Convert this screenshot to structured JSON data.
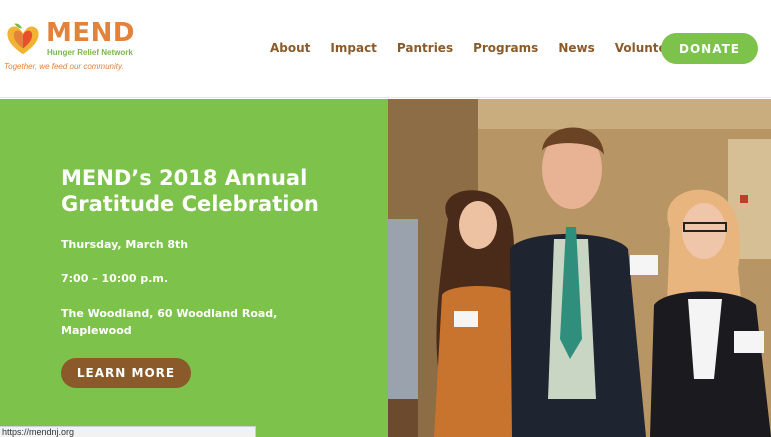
{
  "logo": {
    "word": "MEND",
    "subtitle": "Hunger Relief Network",
    "tagline": "Together, we feed our community."
  },
  "nav": {
    "items": [
      "About",
      "Impact",
      "Pantries",
      "Programs",
      "News",
      "Volunteer"
    ],
    "donate_label": "DONATE"
  },
  "hero": {
    "title": "MEND’s 2018 Annual Gratitude Celebration",
    "date": "Thursday, March 8th",
    "time": "7:00 – 10:00 p.m.",
    "location": "The Woodland, 60 Woodland Road, Maplewood",
    "cta_label": "LEARN MORE"
  },
  "status_bar": {
    "url": "https://mendnj.org"
  },
  "colors": {
    "brand_green": "#7dc24b",
    "brand_brown": "#8a5a2b",
    "brand_orange": "#e2823b"
  }
}
